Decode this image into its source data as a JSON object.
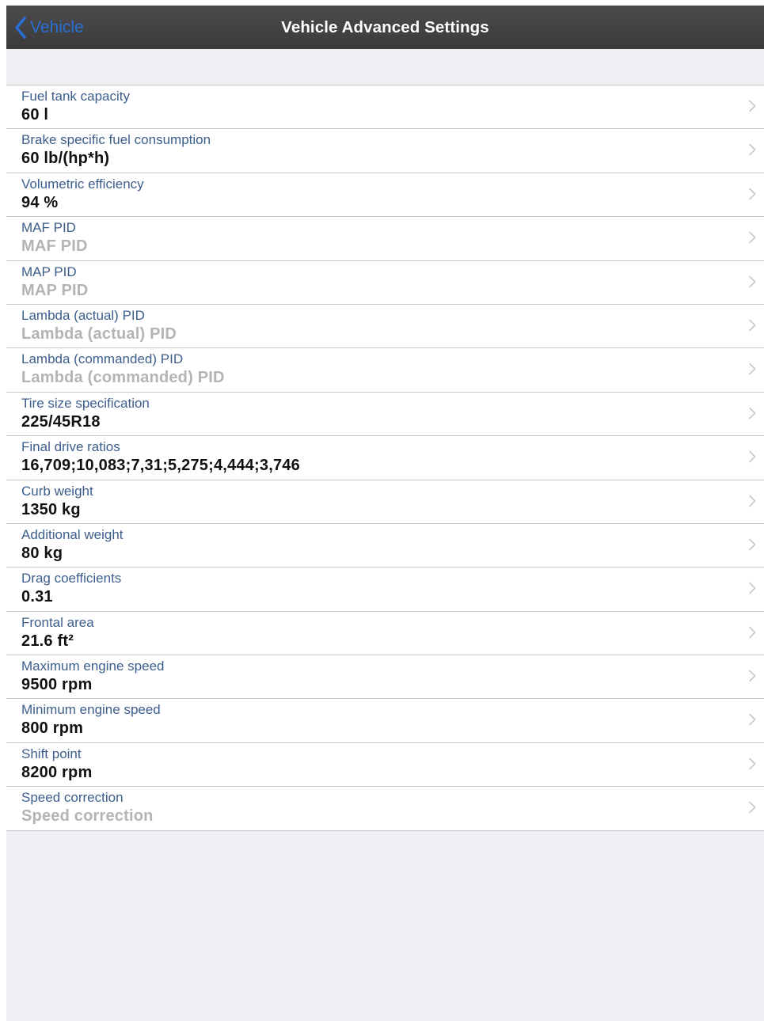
{
  "navbar": {
    "back_label": "Vehicle",
    "title": "Vehicle Advanced Settings"
  },
  "settings": [
    {
      "label": "Fuel tank capacity",
      "value": "60 l",
      "placeholder": false
    },
    {
      "label": "Brake specific fuel consumption",
      "value": "60 lb/(hp*h)",
      "placeholder": false
    },
    {
      "label": "Volumetric efficiency",
      "value": "94 %",
      "placeholder": false
    },
    {
      "label": "MAF PID",
      "value": "MAF PID",
      "placeholder": true
    },
    {
      "label": "MAP PID",
      "value": "MAP PID",
      "placeholder": true
    },
    {
      "label": "Lambda (actual) PID",
      "value": "Lambda (actual) PID",
      "placeholder": true
    },
    {
      "label": "Lambda (commanded) PID",
      "value": "Lambda (commanded) PID",
      "placeholder": true
    },
    {
      "label": "Tire size specification",
      "value": "225/45R18",
      "placeholder": false
    },
    {
      "label": "Final drive ratios",
      "value": "16,709;10,083;7,31;5,275;4,444;3,746",
      "placeholder": false
    },
    {
      "label": "Curb weight",
      "value": "1350 kg",
      "placeholder": false
    },
    {
      "label": "Additional weight",
      "value": "80 kg",
      "placeholder": false
    },
    {
      "label": "Drag coefficients",
      "value": "0.31",
      "placeholder": false
    },
    {
      "label": "Frontal area",
      "value": "21.6 ft²",
      "placeholder": false
    },
    {
      "label": "Maximum engine speed",
      "value": "9500 rpm",
      "placeholder": false
    },
    {
      "label": "Minimum engine speed",
      "value": "800 rpm",
      "placeholder": false
    },
    {
      "label": "Shift point",
      "value": "8200 rpm",
      "placeholder": false
    },
    {
      "label": "Speed correction",
      "value": "Speed correction",
      "placeholder": true
    }
  ],
  "icons": {
    "back": "chevron-left-icon",
    "disclosure": "chevron-right-icon"
  },
  "colors": {
    "accent": "#2a6fd6",
    "label": "#3c5e8c",
    "navbar": "#3b3b3b",
    "background": "#efeff4",
    "separator": "#c8c7cc",
    "placeholder_text": "#b4b4b4"
  }
}
